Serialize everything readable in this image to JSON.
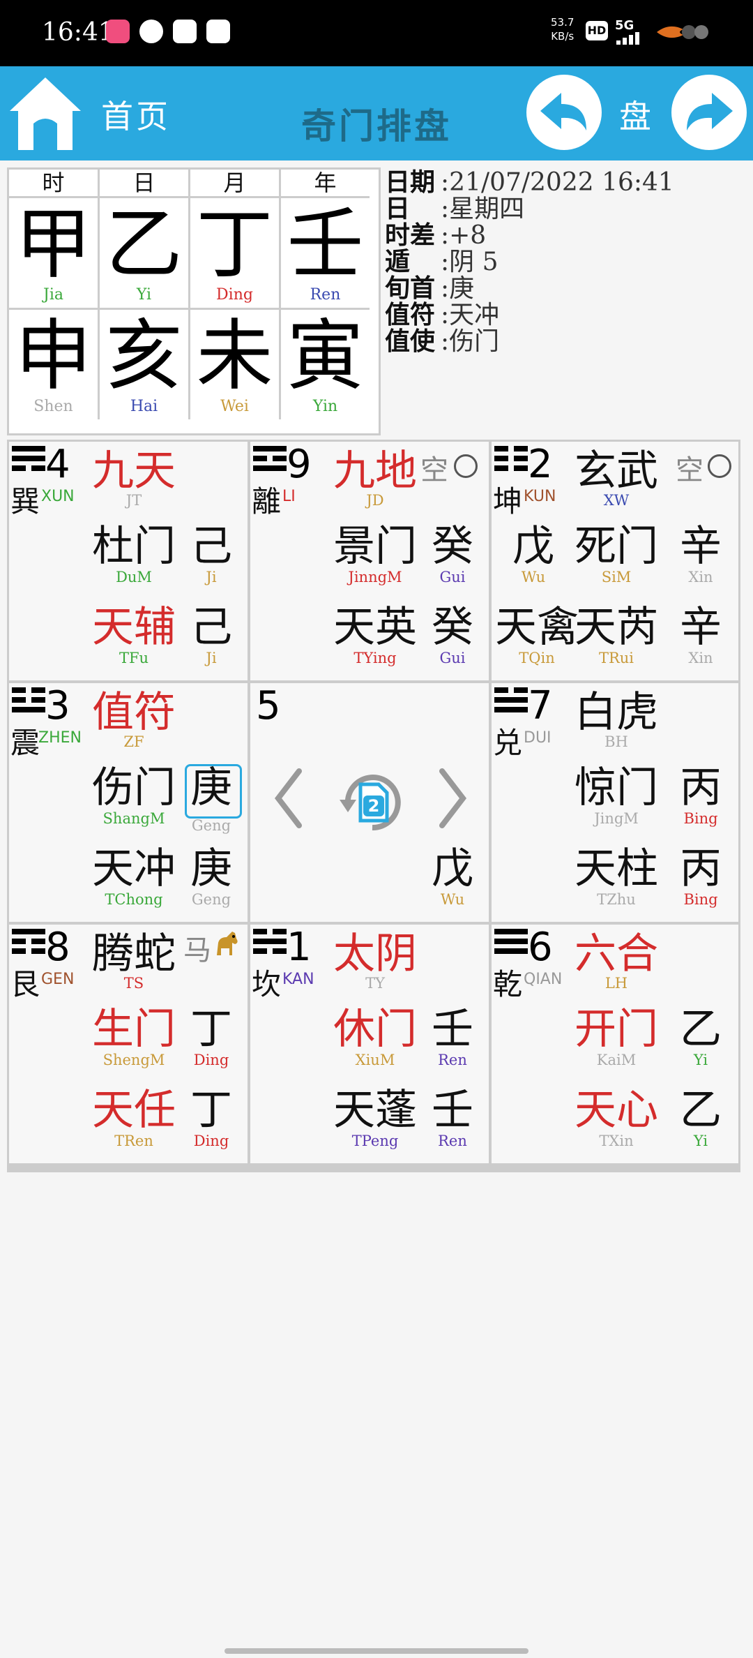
{
  "status_bar": {
    "time": "16:41",
    "speed_value": "53.7",
    "speed_unit": "KB/s",
    "hd": "HD",
    "network": "5G",
    "icons": [
      "app-icon",
      "message-icon",
      "mail-icon",
      "wallet-icon"
    ]
  },
  "header": {
    "home_label": "首页",
    "title": "奇门排盘",
    "pan_label": "盘"
  },
  "pillars": {
    "headers": [
      "时",
      "日",
      "月",
      "年"
    ],
    "stems": [
      {
        "char": "甲",
        "pinyin": "Jia",
        "color": "#3aa83a"
      },
      {
        "char": "乙",
        "pinyin": "Yi",
        "color": "#3aa83a"
      },
      {
        "char": "丁",
        "pinyin": "Ding",
        "color": "#d42c2c"
      },
      {
        "char": "壬",
        "pinyin": "Ren",
        "color": "#3a4ab0"
      }
    ],
    "branches": [
      {
        "char": "申",
        "pinyin": "Shen",
        "color": "#aaa"
      },
      {
        "char": "亥",
        "pinyin": "Hai",
        "color": "#3a4ab0"
      },
      {
        "char": "未",
        "pinyin": "Wei",
        "color": "#c89a3a"
      },
      {
        "char": "寅",
        "pinyin": "Yin",
        "color": "#3aa83a"
      }
    ]
  },
  "info": {
    "date_k": "日期",
    "date_v": ":21/07/2022 16:41",
    "day_k": "日",
    "day_v": ":星期四",
    "diff_k": "时差",
    "diff_v": ":+8",
    "dun_k": "遁",
    "dun_v": ":阴 5",
    "xun_k": "旬首",
    "xun_v": ":庚",
    "zhifu_k": "值符",
    "zhifu_v": ":天冲",
    "zhishi_k": "值使",
    "zhishi_v": ":伤门"
  },
  "palaces": {
    "xun": {
      "num": "4",
      "name": "巽",
      "pinyin": "XUN",
      "god": "九天",
      "god_py": "JT",
      "door": "杜门",
      "door_py": "DuM",
      "door_stem": "己",
      "door_stem_py": "Ji",
      "star": "天辅",
      "star_py": "TFu",
      "star_stem": "己",
      "star_stem_py": "Ji"
    },
    "li": {
      "num": "9",
      "name": "離",
      "pinyin": "LI",
      "god": "九地",
      "god_py": "JD",
      "kong": "空",
      "door": "景门",
      "door_py": "JinngM",
      "door_stem": "癸",
      "door_stem_py": "Gui",
      "star": "天英",
      "star_py": "TYing",
      "star_stem": "癸",
      "star_stem_py": "Gui"
    },
    "kun": {
      "num": "2",
      "name": "坤",
      "pinyin": "KUN",
      "god": "玄武",
      "god_py": "XW",
      "kong": "空",
      "door_left": "戊",
      "door_left_py": "Wu",
      "door": "死门",
      "door_py": "SiM",
      "door_stem": "辛",
      "door_stem_py": "Xin",
      "star_left": "天禽",
      "star_left_py": "TQin",
      "star": "天芮",
      "star_py": "TRui",
      "star_stem": "辛",
      "star_stem_py": "Xin"
    },
    "zhen": {
      "num": "3",
      "name": "震",
      "pinyin": "ZHEN",
      "god": "值符",
      "god_py": "ZF",
      "door": "伤门",
      "door_py": "ShangM",
      "door_stem": "庚",
      "door_stem_py": "Geng",
      "star": "天冲",
      "star_py": "TChong",
      "star_stem": "庚",
      "star_stem_py": "Geng"
    },
    "center": {
      "num": "5",
      "badge": "2",
      "stem": "戊",
      "stem_py": "Wu"
    },
    "dui": {
      "num": "7",
      "name": "兑",
      "pinyin": "DUI",
      "god": "白虎",
      "god_py": "BH",
      "door": "惊门",
      "door_py": "JingM",
      "door_stem": "丙",
      "door_stem_py": "Bing",
      "star": "天柱",
      "star_py": "TZhu",
      "star_stem": "丙",
      "star_stem_py": "Bing"
    },
    "gen": {
      "num": "8",
      "name": "艮",
      "pinyin": "GEN",
      "god": "腾蛇",
      "god_py": "TS",
      "horse": "马",
      "door": "生门",
      "door_py": "ShengM",
      "door_stem": "丁",
      "door_stem_py": "Ding",
      "star": "天任",
      "star_py": "TRen",
      "star_stem": "丁",
      "star_stem_py": "Ding"
    },
    "kan": {
      "num": "1",
      "name": "坎",
      "pinyin": "KAN",
      "god": "太阴",
      "god_py": "TY",
      "door": "休门",
      "door_py": "XiuM",
      "door_stem": "壬",
      "door_stem_py": "Ren",
      "star": "天蓬",
      "star_py": "TPeng",
      "star_stem": "壬",
      "star_stem_py": "Ren"
    },
    "qian": {
      "num": "6",
      "name": "乾",
      "pinyin": "QIAN",
      "god": "六合",
      "god_py": "LH",
      "door": "开门",
      "door_py": "KaiM",
      "door_stem": "乙",
      "door_stem_py": "Yi",
      "star": "天心",
      "star_py": "TXin",
      "star_stem": "乙",
      "star_stem_py": "Yi"
    }
  },
  "colors": {
    "header": "#2aa9df",
    "red": "#d42c2c",
    "title": "#1e6a88"
  }
}
